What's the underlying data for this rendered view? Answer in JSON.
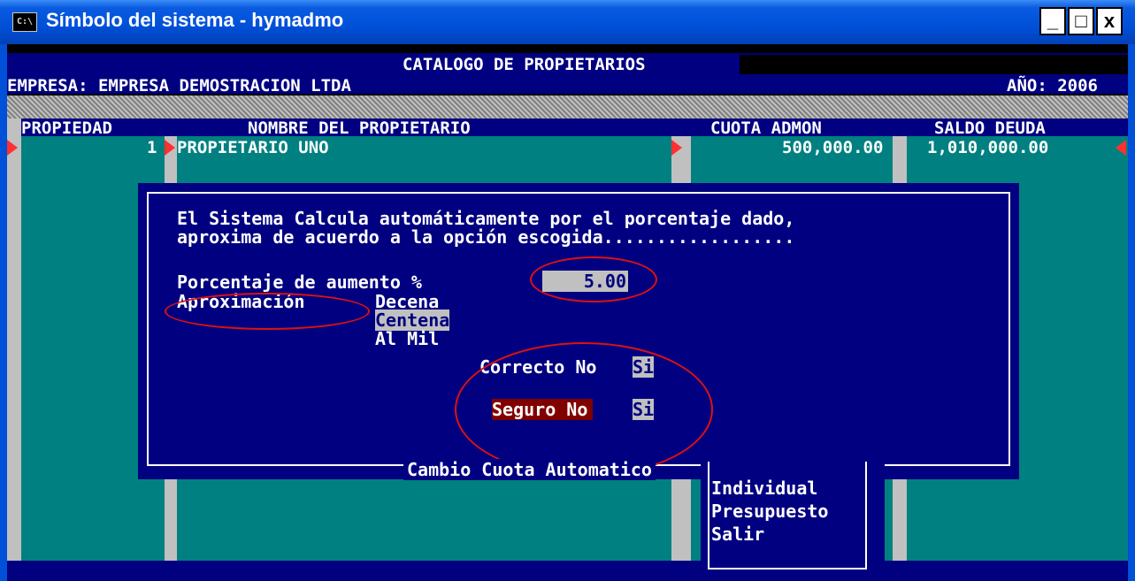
{
  "window": {
    "title": "Símbolo del sistema - hymadmo",
    "icon_label": "C:\\",
    "minimize": "_",
    "maximize": "□",
    "close": "x"
  },
  "header": {
    "title": "CATALOGO DE PROPIETARIOS",
    "empresa": "EMPRESA: EMPRESA DEMOSTRACION LTDA",
    "anio": "AÑO: 2006"
  },
  "table": {
    "columns": [
      "PROPIEDAD",
      "NOMBRE DEL PROPIETARIO",
      "CUOTA ADMON",
      "SALDO DEUDA"
    ],
    "rows": [
      {
        "propiedad": "1",
        "nombre": "PROPIETARIO UNO",
        "cuota": "500,000.00",
        "saldo": "1,010,000.00"
      }
    ]
  },
  "dialog": {
    "line1": "El Sistema Calcula automáticamente por el porcentaje dado,",
    "line2": "aproxima de acuerdo a la opción escogida..................",
    "pct_label": "Porcentaje de aumento %",
    "pct_value": "5.00",
    "aprox_label": "Aproximación",
    "aprox_options": [
      "Decena",
      "Centena",
      "Al Mil"
    ],
    "aprox_selected": "Centena",
    "correcto_label": "Correcto No",
    "correcto_yes": "Si",
    "seguro_label": "Seguro No",
    "seguro_yes": "Si",
    "footer": "Cambio Cuota Automatico"
  },
  "menu": {
    "items": [
      "Individual",
      "Presupuesto",
      "Salir"
    ]
  },
  "colors": {
    "background": "#000080",
    "teal": "#008080",
    "gray": "#c0c0c0",
    "highlight_red": "#800000",
    "annotation_red": "#e01010",
    "xp_title": "#0050d8"
  }
}
